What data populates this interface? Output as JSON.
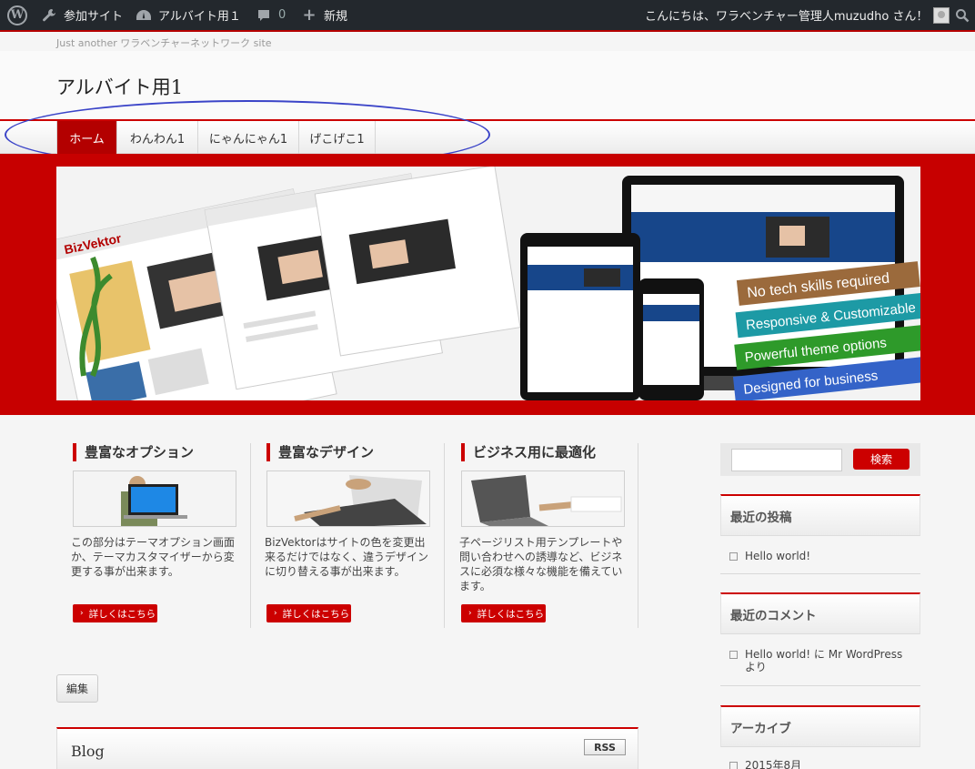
{
  "adminbar": {
    "my_sites": "参加サイト",
    "site_name": "アルバイト用１",
    "comments_count": "0",
    "new_label": "新規",
    "greeting": "こんにちは、ワラベンチャー管理人muzudho さん！"
  },
  "header": {
    "tagline": "Just another ワラベンチャーネットワーク site",
    "site_title": "アルバイト用1"
  },
  "nav": {
    "items": [
      {
        "label": "ホーム",
        "active": true
      },
      {
        "label": "わんわん1",
        "active": false
      },
      {
        "label": "にゃんにゃん1",
        "active": false
      },
      {
        "label": "げこげこ1",
        "active": false
      }
    ]
  },
  "hero": {
    "brand_name": "BizVektor",
    "ribbons": [
      {
        "text": "No tech skills required",
        "color": "#9b6a3c"
      },
      {
        "text": "Responsive & Customizable",
        "color": "#1d9aa5"
      },
      {
        "text": "Powerful theme options",
        "color": "#2e9a2a"
      },
      {
        "text": "Designed for business",
        "color": "#3463c8"
      }
    ]
  },
  "features": [
    {
      "title": "豊富なオプション",
      "text": "この部分はテーマオプション画面か、テーマカスタマイザーから変更する事が出来ます。",
      "button": "詳しくはこちら"
    },
    {
      "title": "豊富なデザイン",
      "text": "BizVektorはサイトの色を変更出来るだけではなく、違うデザインに切り替える事が出来ます。",
      "button": "詳しくはこちら"
    },
    {
      "title": "ビジネス用に最適化",
      "text": "子ページリスト用テンプレートや問い合わせへの誘導など、ビジネスに必須な様々な機能を備えています。",
      "button": "詳しくはこちら"
    }
  ],
  "edit_label": "編集",
  "blog": {
    "title": "Blog",
    "rss_label": "RSS"
  },
  "sidebar": {
    "search_button": "検索",
    "recent_posts_title": "最近の投稿",
    "recent_posts": [
      "Hello world!"
    ],
    "recent_comments_title": "最近のコメント",
    "recent_comments": [
      "Hello world! に Mr WordPress より"
    ],
    "archives_title": "アーカイブ",
    "archives": [
      "2015年8月"
    ]
  },
  "colors": {
    "accent": "#cc0000",
    "admin_bar": "#23282d",
    "annotation": "#3b44c8"
  }
}
